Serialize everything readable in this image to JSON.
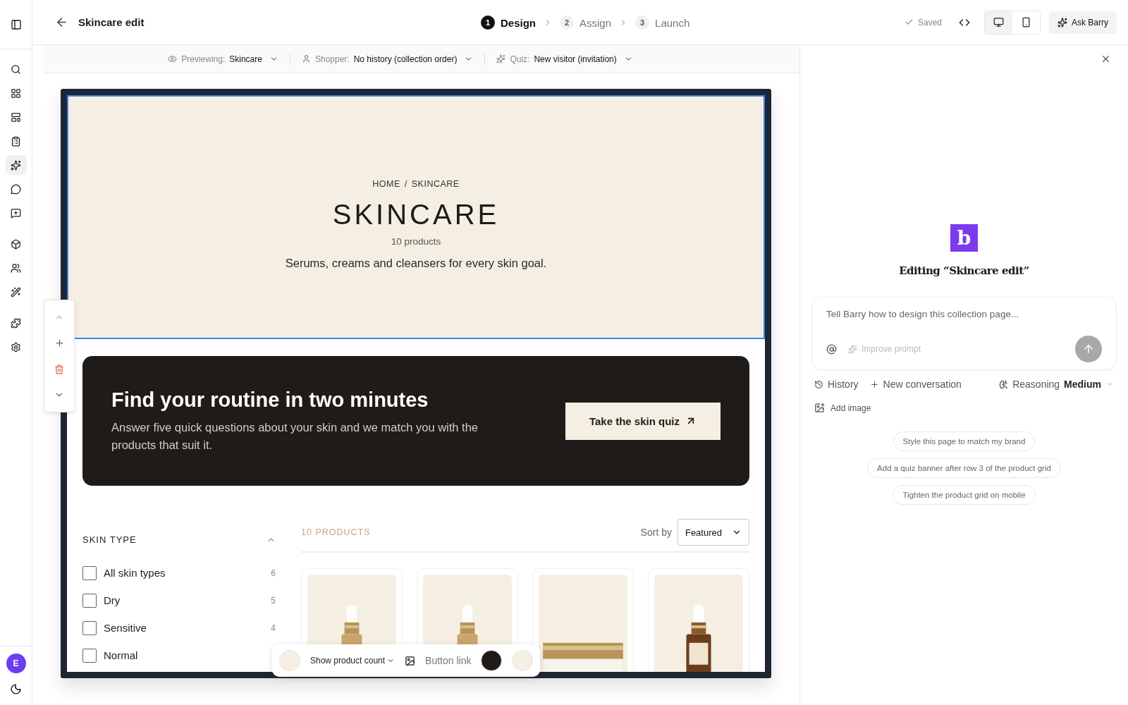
{
  "rail": {
    "items": [
      {
        "selected": false
      },
      {
        "selected": false
      },
      {
        "selected": false
      },
      {
        "selected": false
      },
      {
        "selected": true
      },
      {
        "selected": false
      },
      {
        "selected": false
      },
      {
        "selected": false
      },
      {
        "selected": false
      },
      {
        "selected": false
      },
      {
        "selected": false
      },
      {
        "selected": false
      }
    ],
    "avatar": "E"
  },
  "header": {
    "title": "Skincare edit",
    "steps": [
      {
        "number": "1",
        "label": "Design",
        "selected": true
      },
      {
        "number": "2",
        "label": "Assign",
        "selected": false
      },
      {
        "number": "3",
        "label": "Launch",
        "selected": false
      }
    ],
    "saved": "Saved",
    "devices": [
      {
        "kind": "desktop",
        "selected": true
      },
      {
        "kind": "mobile",
        "selected": false
      }
    ],
    "ask": "Ask Barry"
  },
  "preview_bar": [
    {
      "label": "Previewing:",
      "value": "Skincare"
    },
    {
      "label": "Shopper:",
      "value": "No history (collection order)"
    },
    {
      "label": "Quiz:",
      "value": "New visitor (invitation)"
    }
  ],
  "hero": {
    "breadcrumb": [
      "HOME",
      "/",
      "SKINCARE"
    ],
    "title": "SKINCARE",
    "count": "10 products",
    "description": "Serums, creams and cleansers for every skin goal."
  },
  "banner": {
    "title": "Find your routine in two minutes",
    "body": "Answer five quick questions about your skin and we match you with the products that suit it.",
    "button": "Take the skin quiz"
  },
  "filters": {
    "title": "SKIN TYPE",
    "expanded": true,
    "options": [
      {
        "label": "All skin types",
        "count": "6",
        "checked": false
      },
      {
        "label": "Dry",
        "count": "5",
        "checked": false
      },
      {
        "label": "Sensitive",
        "count": "4",
        "checked": false
      },
      {
        "label": "Normal",
        "checked": false
      }
    ]
  },
  "products": {
    "count": "10 PRODUCTS",
    "sort_label": "Sort by",
    "sort_value": "Featured"
  },
  "block_toolbar": {
    "show_count": "Show product count",
    "link": "Button link",
    "swatches": [
      {
        "color": "#f5efe3"
      },
      {
        "color": "#1f1b18"
      },
      {
        "color": "#f5efe3"
      }
    ]
  },
  "assistant": {
    "logo": "b",
    "title": "Editing “Skincare edit”",
    "placeholder": "Tell Barry how to design this collection page...",
    "improve": "Improve prompt",
    "history": "History",
    "new_conversation": "New conversation",
    "reasoning_label": "Reasoning",
    "reasoning_value": "Medium",
    "add_image": "Add image",
    "suggestions": [
      "Style this page to match my brand",
      "Add a quiz banner after row 3 of the product grid",
      "Tighten the product grid on mobile"
    ]
  }
}
